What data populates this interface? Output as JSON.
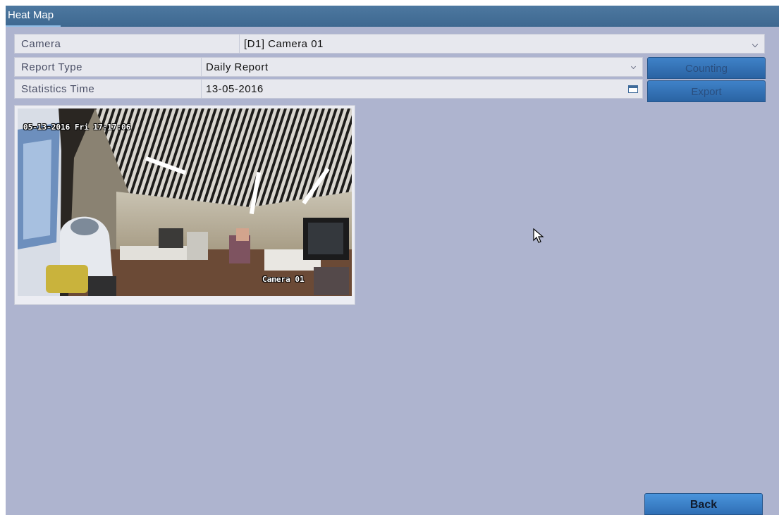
{
  "window": {
    "title": "Heat Map"
  },
  "form": {
    "camera": {
      "label": "Camera",
      "value": "[D1] Camera 01"
    },
    "report_type": {
      "label": "Report Type",
      "value": "Daily Report"
    },
    "statistics_time": {
      "label": "Statistics Time",
      "value": "13-05-2016"
    }
  },
  "buttons": {
    "counting": "Counting",
    "export": "Export",
    "back": "Back"
  },
  "preview": {
    "timestamp_osd": "05-13-2016 Fri 17:17:06",
    "camera_osd": "Camera 01"
  },
  "icons": {
    "dropdown": "chevron-down-icon",
    "calendar": "calendar-icon",
    "cursor": "mouse-pointer-icon"
  },
  "colors": {
    "background": "#aeb4cf",
    "title_bar": "#3e6890",
    "button": "#2f6fb5"
  }
}
